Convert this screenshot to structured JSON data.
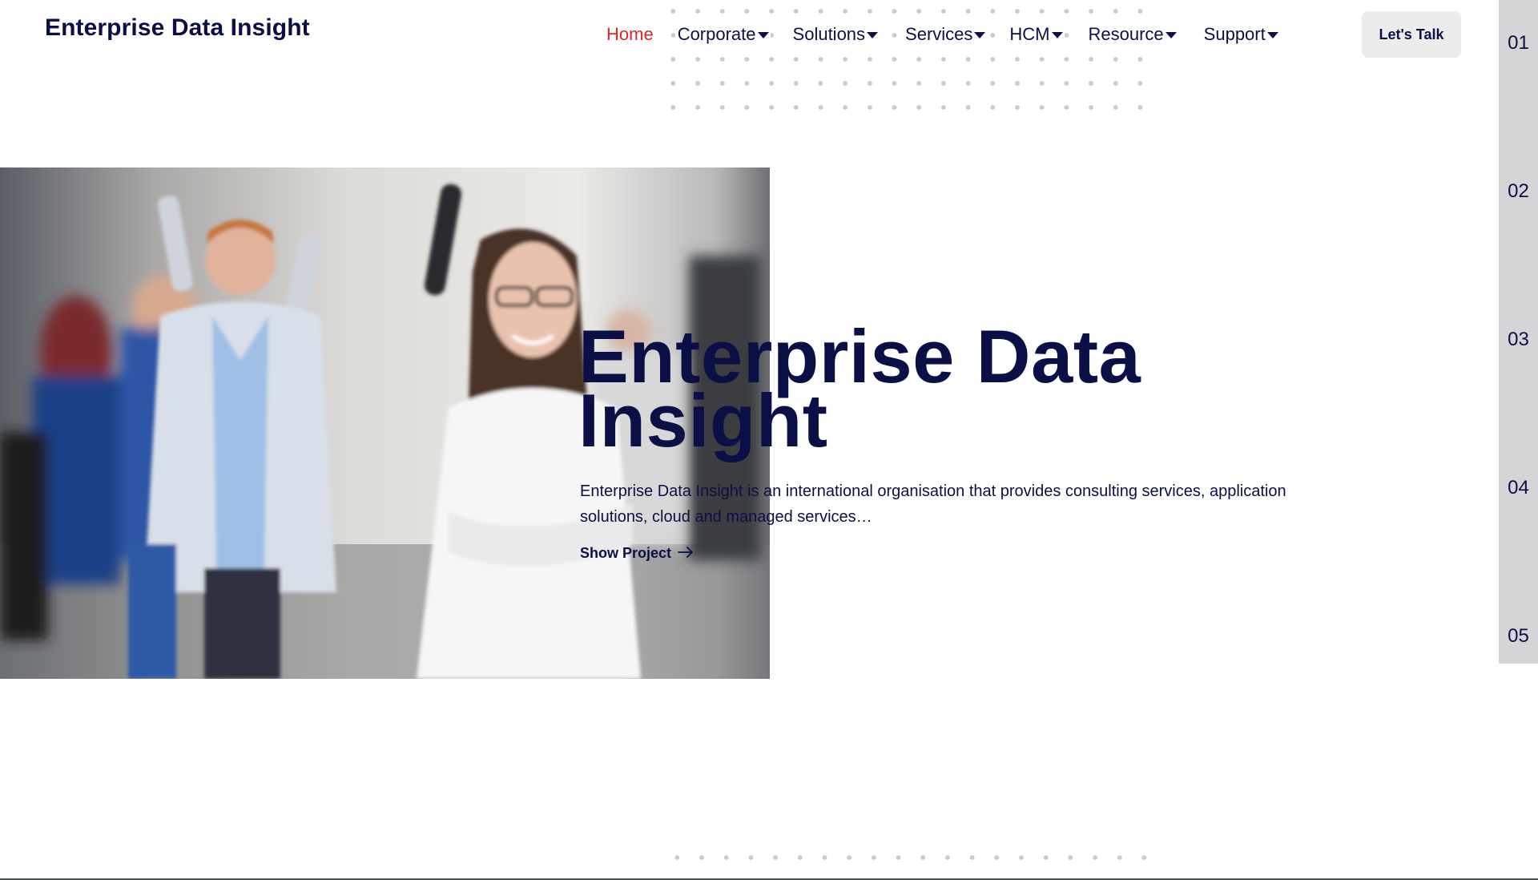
{
  "header": {
    "brand": "Enterprise Data Insight",
    "nav": [
      {
        "label": "Home",
        "active": true,
        "has_dropdown": false
      },
      {
        "label": "Corporate",
        "active": false,
        "has_dropdown": true
      },
      {
        "label": "Solutions",
        "active": false,
        "has_dropdown": true
      },
      {
        "label": "Services",
        "active": false,
        "has_dropdown": true
      },
      {
        "label": "HCM",
        "active": false,
        "has_dropdown": true
      },
      {
        "label": "Resource",
        "active": false,
        "has_dropdown": true
      },
      {
        "label": "Support",
        "active": false,
        "has_dropdown": true
      }
    ],
    "cta_label": "Let's Talk"
  },
  "hero": {
    "title_line1": "Enterprise Data",
    "title_line2": "Insight",
    "description": "Enterprise Data Insight is an international organisation that provides consulting services, application solutions, cloud  and managed services…",
    "link_label": "Show Project",
    "link_icon": "arrow-right-icon",
    "image": "celebrating-office-team-photo"
  },
  "slide_index": [
    "01",
    "02",
    "03",
    "04",
    "05"
  ],
  "colors": {
    "primary": "#0a1045",
    "active_nav": "#e3262b",
    "cta_bg": "#ececed",
    "rail_bg": "#d5d5d7"
  }
}
